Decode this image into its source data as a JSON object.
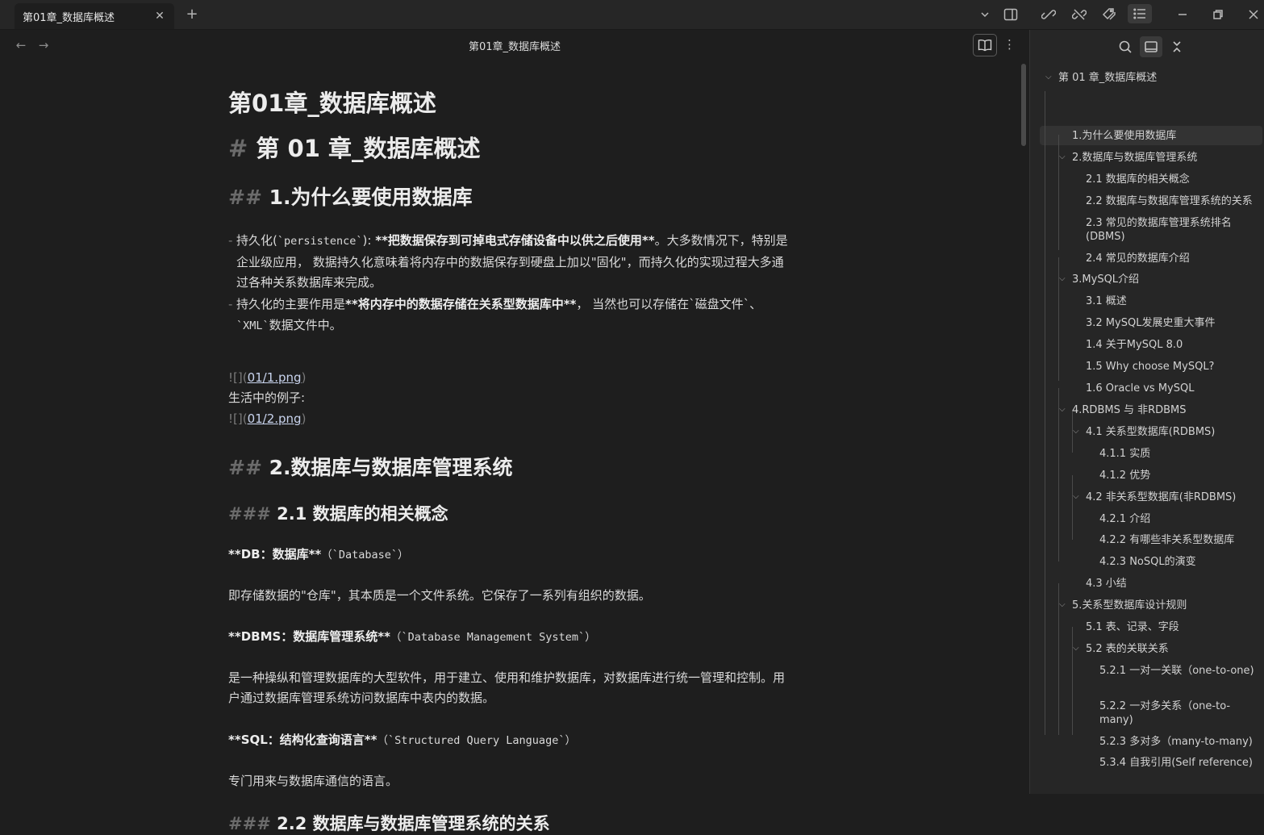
{
  "tab": {
    "title": "第01章_数据库概述",
    "close": "✕",
    "new_tab": "+"
  },
  "view_header": {
    "title": "第01章_数据库概述",
    "back": "←",
    "forward": "→",
    "more": "⋮"
  },
  "document": {
    "file_title": "第01章_数据库概述",
    "h1_mark": "#",
    "h1_text": "第 01 章_数据库概述",
    "h2_mark": "##",
    "h3_mark": "###",
    "sec1_title": "1.为什么要使用数据库",
    "bullet_dash": "-",
    "b1_a": "持久化(",
    "b1_code": "`persistence`",
    "b1_b": "): ",
    "b1_strong": "**把数据保存到可掉电式存储设备中以供之后使用**",
    "b1_c": "。大多数情况下，特别是企业级应用， 数据持久化意味着将内存中的数据保存到硬盘上加以\"固化\"，而持久化的实现过程大多通过各种关系数据库来完成。",
    "b2_a": "持久化的主要作用是",
    "b2_strong": "**将内存中的数据存储在关系型数据库中**",
    "b2_b": "， 当然也可以存储在`磁盘文件`、",
    "b2_code": "`XML`",
    "b2_c": "数据文件中。",
    "img1_prefix": "![](",
    "img1_link": "01/1.png",
    "img_suffix": ")",
    "life_example": "生活中的例子:",
    "img2_prefix": "![](",
    "img2_link": "01/2.png",
    "sec2_title": "2.数据库与数据库管理系统",
    "sec21_title": "2.1 数据库的相关概念",
    "db_strong": "**DB：数据库**",
    "db_code": "（`Database`）",
    "db_desc": "即存储数据的\"仓库\"，其本质是一个文件系统。它保存了一系列有组织的数据。",
    "dbms_strong": "**DBMS：数据库管理系统**",
    "dbms_code": "（`Database Management System`）",
    "dbms_desc": "是一种操纵和管理数据库的大型软件，用于建立、使用和维护数据库，对数据库进行统一管理和控制。用户通过数据库管理系统访问数据库中表内的数据。",
    "sql_strong": "**SQL：结构化查询语言**",
    "sql_code": "（`Structured Query Language`）",
    "sql_desc": "专门用来与数据库通信的语言。",
    "sec22_title": "2.2 数据库与数据库管理系统的关系"
  },
  "outline": {
    "root": "第 01 章_数据库概述",
    "items": [
      "1.为什么要使用数据库",
      "2.数据库与数据库管理系统",
      "2.1 数据库的相关概念",
      "2.2 数据库与数据库管理系统的关系",
      "2.3 常见的数据库管理系统排名(DBMS)",
      "2.4 常见的数据库介绍",
      "3.MySQL介绍",
      "3.1 概述",
      "3.2 MySQL发展史重大事件",
      "1.4 关于MySQL 8.0",
      "1.5 Why choose MySQL?",
      "1.6 Oracle vs MySQL",
      "4.RDBMS 与 非RDBMS",
      "4.1 关系型数据库(RDBMS)",
      "4.1.1 实质",
      "4.1.2 优势",
      "4.2 非关系型数据库(非RDBMS)",
      "4.2.1 介绍",
      "4.2.2 有哪些非关系型数据库",
      "4.2.3 NoSQL的演变",
      "4.3 小结",
      "5.关系型数据库设计规则",
      "5.1 表、记录、字段",
      "5.2 表的关联关系",
      "5.2.1 一对一关联（one-to-one)",
      "5.2.2 一对多关系（one-to-many)",
      "5.2.3 多对多（many-to-many)",
      "5.3.4 自我引用(Self reference)"
    ]
  }
}
